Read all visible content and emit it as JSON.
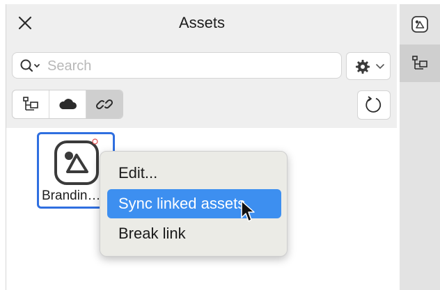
{
  "header": {
    "title": "Assets"
  },
  "search": {
    "placeholder": "Search",
    "value": ""
  },
  "filters": [
    {
      "icon": "hierarchy-icon",
      "active": false
    },
    {
      "icon": "cloud-icon",
      "active": false
    },
    {
      "icon": "link-icon",
      "active": true
    }
  ],
  "assets": [
    {
      "name": "Brandin…",
      "icon": "asset-library-icon",
      "selected": true
    }
  ],
  "context_menu": {
    "items": [
      {
        "label": "Edit...",
        "highlighted": false
      },
      {
        "label": "Sync linked assets",
        "highlighted": true
      },
      {
        "label": "Break link",
        "highlighted": false
      }
    ]
  },
  "side_rail": [
    {
      "icon": "asset-library-icon",
      "active": false
    },
    {
      "icon": "hierarchy-icon",
      "active": true
    }
  ],
  "colors": {
    "selection": "#2f6fe0",
    "menu_highlight": "#3d8ff0",
    "panel_bg": "#efefef"
  }
}
